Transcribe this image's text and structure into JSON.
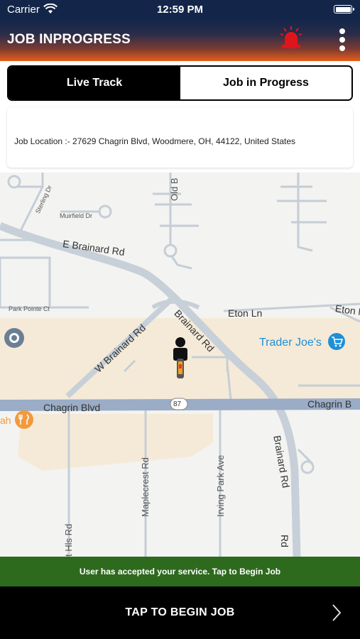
{
  "status_bar": {
    "carrier": "Carrier",
    "time": "12:59 PM"
  },
  "header": {
    "title": "JOB INPROGRESS"
  },
  "tabs": [
    {
      "label": "Live Track",
      "active": true
    },
    {
      "label": "Job in Progress",
      "active": false
    }
  ],
  "job_location": {
    "text": "Job Location :- 27629 Chagrin Blvd, Woodmere, OH, 44122, United States"
  },
  "map": {
    "labels": {
      "e_brainard": "E Brainard Rd",
      "w_brainard": "W Brainard Rd",
      "brainard_diag": "Brainard Rd",
      "brainard_vert": "Brainard Rd",
      "brainard_vert2": "Rd",
      "eton_ln": "Eton Ln",
      "eton_right": "Eton N",
      "trader_joes": "Trader Joe's",
      "chagrin_left": "Chagrin Blvd",
      "chagrin_right": "Chagrin B",
      "route_87": "87",
      "maplecrest": "Maplecrest Rd",
      "irving_park": "Irving Park Ave",
      "hls_rd": "t Hls Rd",
      "old_b": "Old B",
      "park_pointe": "Park Pointe Ct",
      "muirfield": "Muirfield Dr",
      "sterling": "Sterling Dr",
      "ah": "ah"
    },
    "colors": {
      "land": "#f3f3f1",
      "commercial": "#f5ead7",
      "major_road": "#9aacc6",
      "road": "#c5ced6"
    }
  },
  "notice": {
    "text": "User has accepted your service. Tap to Begin Job"
  },
  "cta": {
    "label": "TAP TO BEGIN JOB"
  },
  "icons": {
    "wifi": "wifi-icon",
    "battery": "battery-icon",
    "siren": "siren-icon",
    "more": "more-vertical-icon",
    "driver": "driver-marker-icon",
    "shopping": "shopping-cart-icon",
    "restaurant": "fork-knife-icon",
    "chevron": "chevron-right-icon",
    "location": "location-pin-icon"
  }
}
